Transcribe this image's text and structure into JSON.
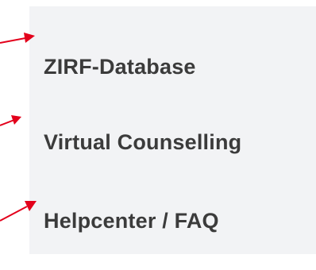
{
  "nav": {
    "items": [
      {
        "label": "ZIRF-Database"
      },
      {
        "label": "Virtual Counselling"
      },
      {
        "label": "Helpcenter / FAQ"
      }
    ]
  },
  "colors": {
    "panel_background": "#f2f3f5",
    "link_text": "#3b3b3b",
    "annotation_arrow": "#e3001b"
  },
  "annotations": {
    "arrow_icons": [
      "arrow-right-icon",
      "arrow-up-right-icon",
      "arrow-up-right-icon"
    ]
  }
}
